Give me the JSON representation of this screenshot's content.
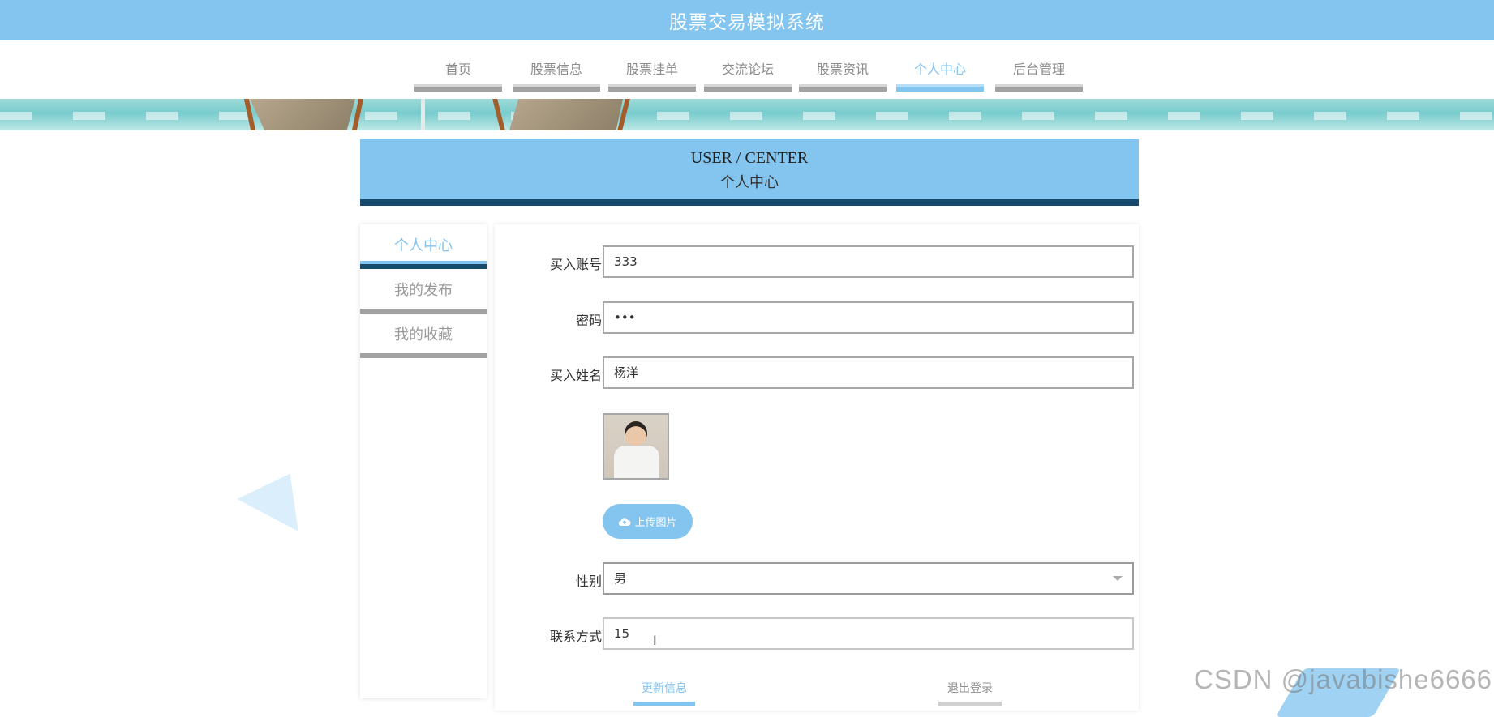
{
  "header": {
    "title": "股票交易模拟系统"
  },
  "nav": {
    "items": [
      {
        "label": "首页"
      },
      {
        "label": "股票信息"
      },
      {
        "label": "股票挂单"
      },
      {
        "label": "交流论坛"
      },
      {
        "label": "股票资讯"
      },
      {
        "label": "个人中心",
        "active": true
      },
      {
        "label": "后台管理"
      }
    ]
  },
  "hero": {
    "en": "USER / CENTER",
    "cn": "个人中心"
  },
  "sidebar": {
    "items": [
      {
        "label": "个人中心",
        "active": true
      },
      {
        "label": "我的发布"
      },
      {
        "label": "我的收藏"
      }
    ]
  },
  "form": {
    "account": {
      "label": "买入账号",
      "value": "333"
    },
    "password": {
      "label": "密码",
      "value": "•••"
    },
    "name": {
      "label": "买入姓名",
      "value": "杨洋"
    },
    "upload_label": "上传图片",
    "gender": {
      "label": "性别",
      "value": "男"
    },
    "contact": {
      "label": "联系方式",
      "value": "15"
    },
    "update_label": "更新信息",
    "logout_label": "退出登录"
  },
  "watermark": "CSDN @javabishe6666",
  "colors": {
    "accent": "#84c5f0",
    "dark": "#174b6e",
    "muted": "#a2a2a2"
  },
  "icons": {
    "upload": "cloud-upload-icon",
    "dropdown": "chevron-down-icon",
    "cursor": "text-cursor-icon"
  }
}
